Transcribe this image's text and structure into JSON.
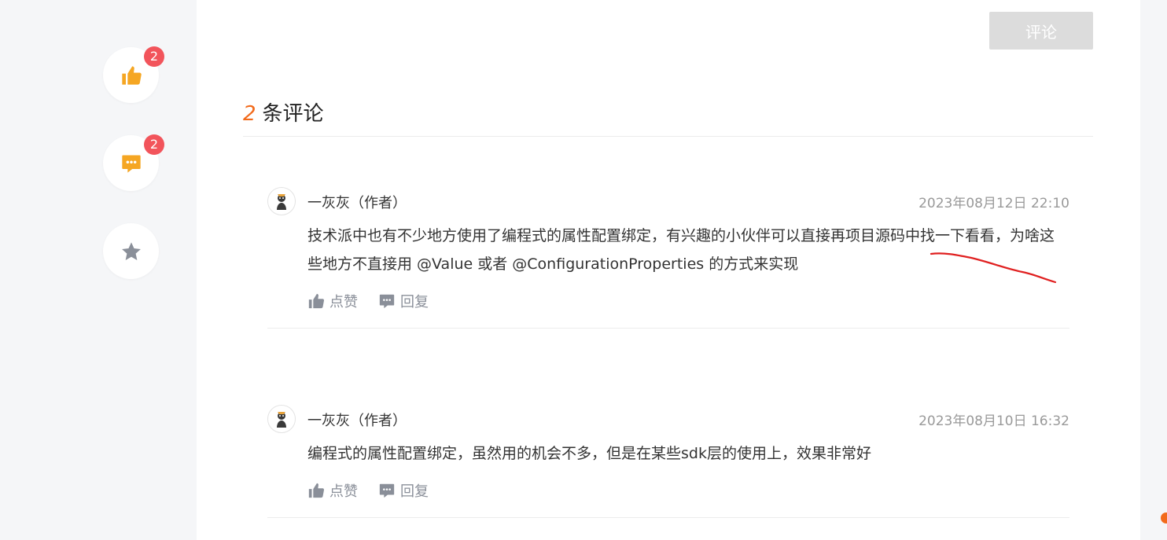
{
  "sidebar": {
    "like": {
      "icon": "thumbs-up-icon",
      "count": "2"
    },
    "comment": {
      "icon": "comment-bubble-icon",
      "count": "2"
    },
    "favorite": {
      "icon": "star-icon"
    }
  },
  "editor": {
    "submit_label": "评论"
  },
  "comments_header": {
    "count": "2",
    "label": "条评论"
  },
  "comments": [
    {
      "author": "一灰灰（作者）",
      "time": "2023年08月12日 22:10",
      "content": "技术派中也有不少地方使用了编程式的属性配置绑定，有兴趣的小伙伴可以直接再项目源码中找一下看看，为啥这些地方不直接用 @Value 或者 @ConfigurationProperties 的方式来实现",
      "like_label": "点赞",
      "reply_label": "回复"
    },
    {
      "author": "一灰灰（作者）",
      "time": "2023年08月10日 16:32",
      "content": "编程式的属性配置绑定，虽然用的机会不多，但是在某些sdk层的使用上，效果非常好",
      "like_label": "点赞",
      "reply_label": "回复"
    }
  ],
  "colors": {
    "accent": "#f26a1b",
    "icon_orange": "#f5a623",
    "badge": "#f2545b",
    "muted": "#8a8f99",
    "annotation": "#e02020"
  }
}
